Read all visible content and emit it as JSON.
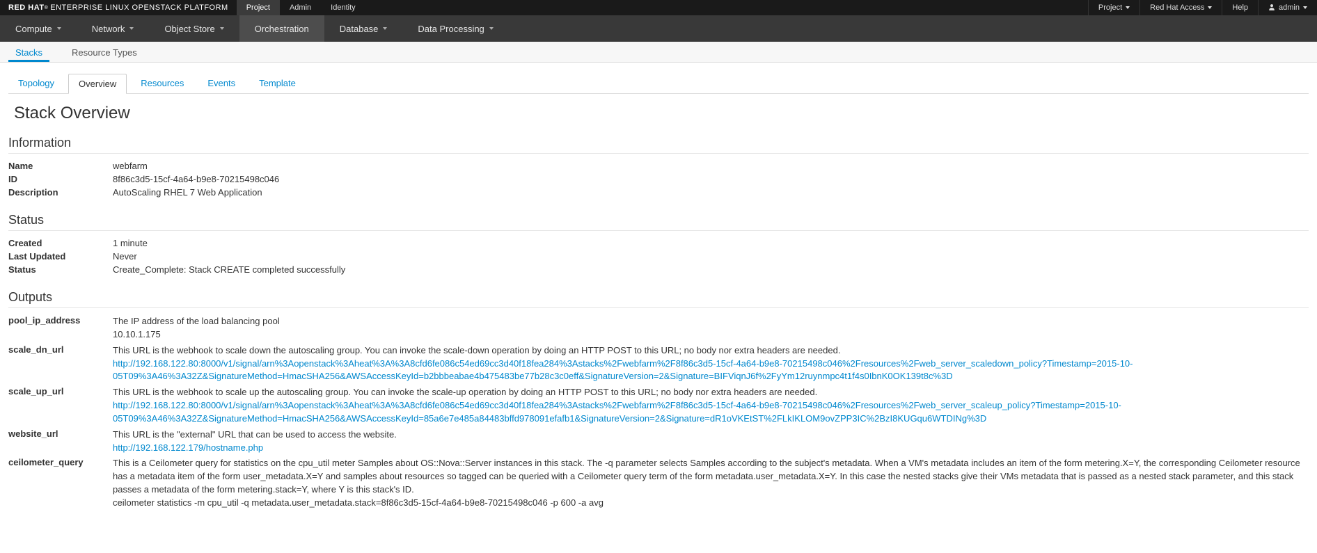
{
  "brand": {
    "prefix": "RED HAT",
    "suffix": "ENTERPRISE LINUX OPENSTACK PLATFORM"
  },
  "topnav": {
    "items": [
      {
        "label": "Project",
        "active": true
      },
      {
        "label": "Admin"
      },
      {
        "label": "Identity"
      }
    ],
    "right": [
      {
        "label": "Project",
        "caret": true
      },
      {
        "label": "Red Hat Access",
        "caret": true
      },
      {
        "label": "Help"
      },
      {
        "label": "admin",
        "caret": true,
        "user": true
      }
    ]
  },
  "mainnav": [
    {
      "label": "Compute",
      "caret": true
    },
    {
      "label": "Network",
      "caret": true
    },
    {
      "label": "Object Store",
      "caret": true
    },
    {
      "label": "Orchestration",
      "active": true
    },
    {
      "label": "Database",
      "caret": true
    },
    {
      "label": "Data Processing",
      "caret": true
    }
  ],
  "subnav": [
    {
      "label": "Stacks",
      "active": true
    },
    {
      "label": "Resource Types"
    }
  ],
  "stack_tabs": [
    {
      "label": "Topology"
    },
    {
      "label": "Overview",
      "active": true
    },
    {
      "label": "Resources"
    },
    {
      "label": "Events"
    },
    {
      "label": "Template"
    }
  ],
  "page_title": "Stack Overview",
  "sections": {
    "information": {
      "title": "Information",
      "rows": [
        {
          "label": "Name",
          "value": "webfarm"
        },
        {
          "label": "ID",
          "value": "8f86c3d5-15cf-4a64-b9e8-70215498c046"
        },
        {
          "label": "Description",
          "value": "AutoScaling RHEL 7 Web Application"
        }
      ]
    },
    "status": {
      "title": "Status",
      "rows": [
        {
          "label": "Created",
          "value": "1 minute"
        },
        {
          "label": "Last Updated",
          "value": "Never"
        },
        {
          "label": "Status",
          "value": "Create_Complete: Stack CREATE completed successfully"
        }
      ]
    },
    "outputs": {
      "title": "Outputs",
      "rows": [
        {
          "label": "pool_ip_address",
          "desc": "The IP address of the load balancing pool",
          "value": "10.10.1.175"
        },
        {
          "label": "scale_dn_url",
          "desc": "This URL is the webhook to scale down the autoscaling group. You can invoke the scale-down operation by doing an HTTP POST to this URL; no body nor extra headers are needed.",
          "link": "http://192.168.122.80:8000/v1/signal/arn%3Aopenstack%3Aheat%3A%3A8cfd6fe086c54ed69cc3d40f18fea284%3Astacks%2Fwebfarm%2F8f86c3d5-15cf-4a64-b9e8-70215498c046%2Fresources%2Fweb_server_scaledown_policy?Timestamp=2015-10-05T09%3A46%3A32Z&SignatureMethod=HmacSHA256&AWSAccessKeyId=b2bbbeabae4b475483be77b28c3c0eff&SignatureVersion=2&Signature=BIFViqnJ6f%2FyYm12ruynmpc4t1f4s0IbnK0OK139t8c%3D"
        },
        {
          "label": "scale_up_url",
          "desc": "This URL is the webhook to scale up the autoscaling group. You can invoke the scale-up operation by doing an HTTP POST to this URL; no body nor extra headers are needed.",
          "link": "http://192.168.122.80:8000/v1/signal/arn%3Aopenstack%3Aheat%3A%3A8cfd6fe086c54ed69cc3d40f18fea284%3Astacks%2Fwebfarm%2F8f86c3d5-15cf-4a64-b9e8-70215498c046%2Fresources%2Fweb_server_scaleup_policy?Timestamp=2015-10-05T09%3A46%3A32Z&SignatureMethod=HmacSHA256&AWSAccessKeyId=85a6e7e485a84483bffd978091efafb1&SignatureVersion=2&Signature=dR1oVKEtST%2FLkIKLOM9ovZPP3IC%2BzI8KUGqu6WTDINg%3D"
        },
        {
          "label": "website_url",
          "desc": "This URL is the \"external\" URL that can be used to access the website.",
          "link": "http://192.168.122.179/hostname.php"
        },
        {
          "label": "ceilometer_query",
          "desc": "This is a Ceilometer query for statistics on the cpu_util meter Samples about OS::Nova::Server instances in this stack. The -q parameter selects Samples according to the subject's metadata. When a VM's metadata includes an item of the form metering.X=Y, the corresponding Ceilometer resource has a metadata item of the form user_metadata.X=Y and samples about resources so tagged can be queried with a Ceilometer query term of the form metadata.user_metadata.X=Y. In this case the nested stacks give their VMs metadata that is passed as a nested stack parameter, and this stack passes a metadata of the form metering.stack=Y, where Y is this stack's ID.",
          "value": "ceilometer statistics -m cpu_util -q metadata.user_metadata.stack=8f86c3d5-15cf-4a64-b9e8-70215498c046 -p 600 -a avg"
        }
      ]
    }
  }
}
